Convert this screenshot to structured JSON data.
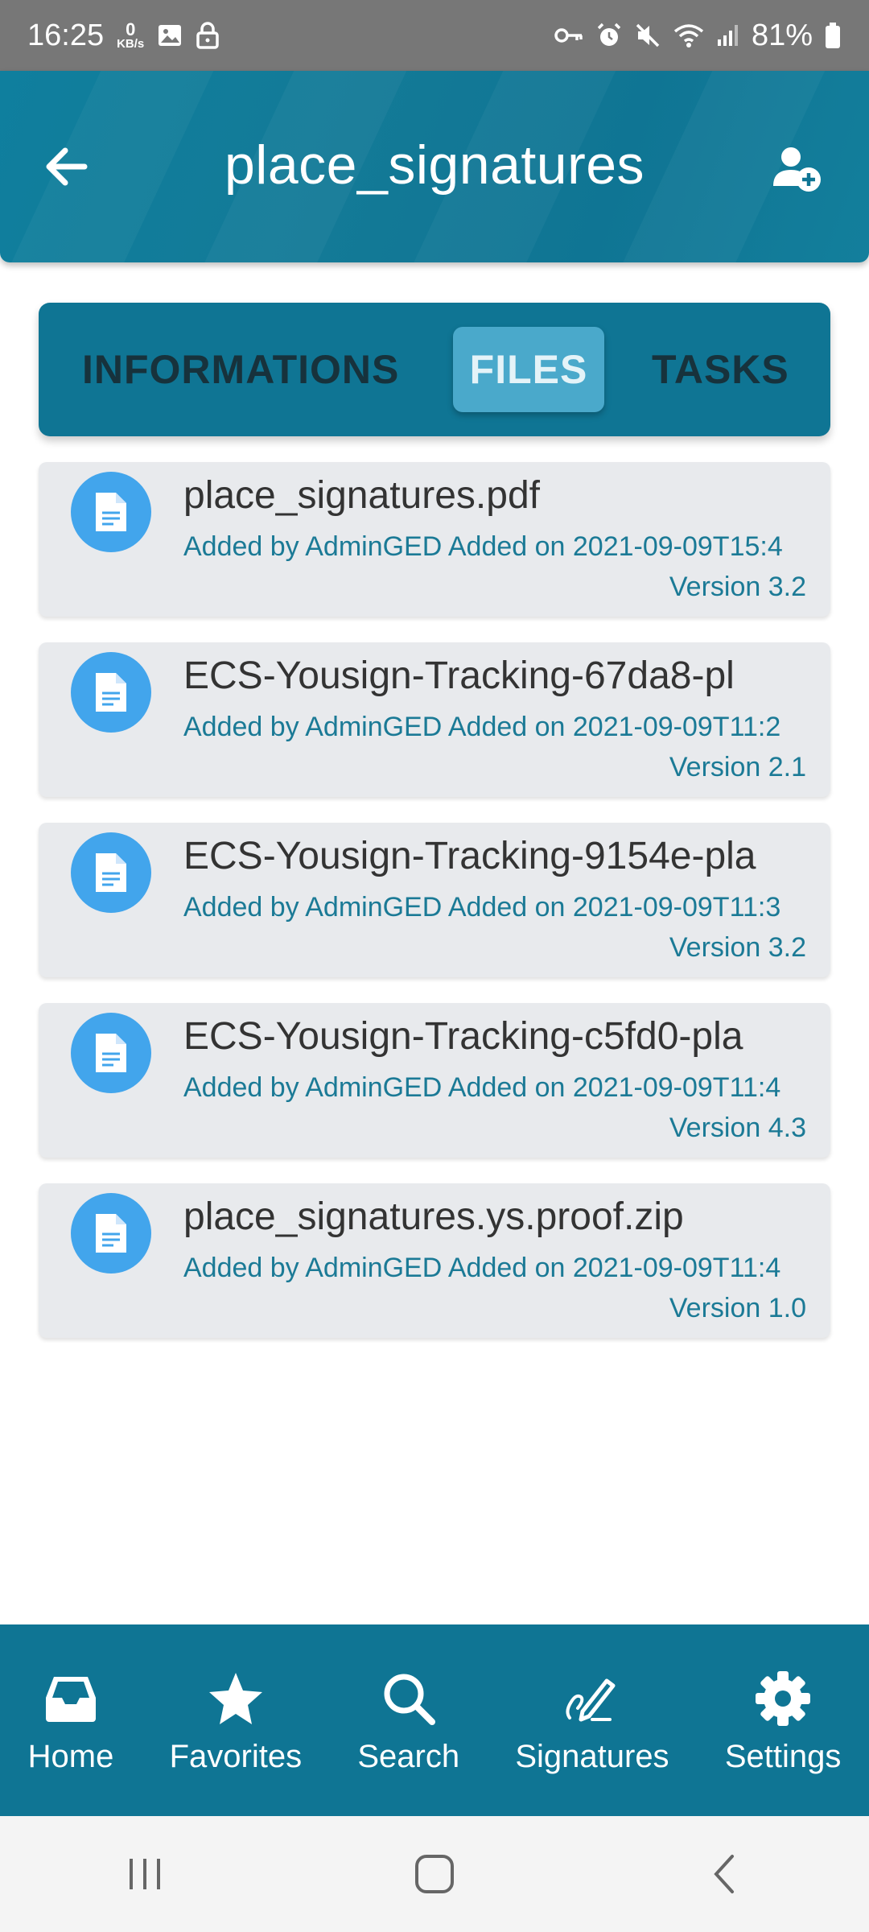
{
  "status_bar": {
    "time": "16:25",
    "net_speed_value": "0",
    "net_speed_unit": "KB/s",
    "battery": "81%",
    "icons": [
      "image-icon",
      "lock-icon",
      "key-icon",
      "alarm-icon",
      "mute-icon",
      "wifi-icon",
      "signal-icon",
      "battery-icon"
    ]
  },
  "header": {
    "title": "place_signatures",
    "back_icon": "arrow-left-icon",
    "action_icon": "add-user-icon"
  },
  "tabs": [
    {
      "label": "INFORMATIONS",
      "active": false
    },
    {
      "label": "FILES",
      "active": true
    },
    {
      "label": "TASKS",
      "active": false
    }
  ],
  "files": [
    {
      "name": "place_signatures.pdf",
      "meta": "Added by AdminGED Added on 2021-09-09T15:4",
      "version": "Version 3.2"
    },
    {
      "name": "ECS-Yousign-Tracking-67da8-pl",
      "meta": "Added by AdminGED Added on 2021-09-09T11:2",
      "version": "Version 2.1"
    },
    {
      "name": "ECS-Yousign-Tracking-9154e-pla",
      "meta": "Added by AdminGED Added on 2021-09-09T11:3",
      "version": "Version 3.2"
    },
    {
      "name": "ECS-Yousign-Tracking-c5fd0-pla",
      "meta": "Added by AdminGED Added on 2021-09-09T11:4",
      "version": "Version 4.3"
    },
    {
      "name": "place_signatures.ys.proof.zip",
      "meta": "Added by AdminGED Added on 2021-09-09T11:4",
      "version": "Version 1.0"
    }
  ],
  "bottom_nav": [
    {
      "label": "Home",
      "icon": "inbox-icon"
    },
    {
      "label": "Favorites",
      "icon": "star-icon"
    },
    {
      "label": "Search",
      "icon": "search-icon"
    },
    {
      "label": "Signatures",
      "icon": "signature-icon"
    },
    {
      "label": "Settings",
      "icon": "gear-icon"
    }
  ],
  "colors": {
    "primary": "#0f7594",
    "active_tab": "#4aa9cb",
    "file_icon": "#42a5ec",
    "meta_text": "#1b7a96",
    "card_bg": "#e8eaed"
  }
}
